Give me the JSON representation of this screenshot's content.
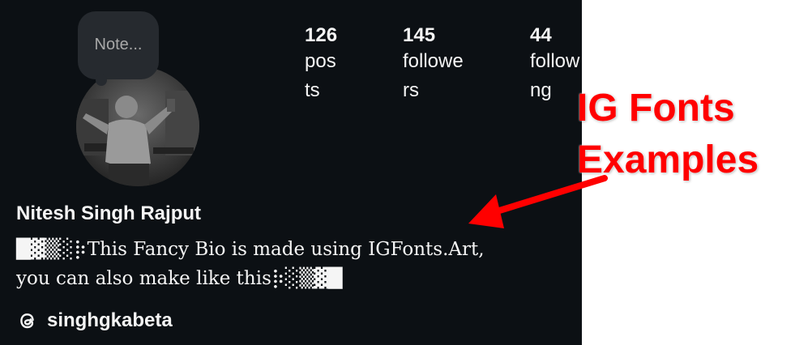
{
  "note": {
    "placeholder": "Note..."
  },
  "stats": [
    {
      "count": "126",
      "label_lines": [
        "pos",
        "ts"
      ]
    },
    {
      "count": "145",
      "label_lines": [
        "followe",
        "rs"
      ]
    },
    {
      "count": "44",
      "label_lines": [
        "follow",
        "ng"
      ]
    }
  ],
  "profile": {
    "full_name": "Nitesh Singh Rajput",
    "bio": "█▓▒░⡷This Fancy Bio is made using IGFonts.Art,\nyou can also make like this⡷░▒▓█",
    "threads_handle": "singhgkabeta"
  },
  "annotation": {
    "line1": "IG Fonts",
    "line2": "Examples",
    "color": "#ff0000"
  },
  "icons": {
    "threads": "threads-icon"
  },
  "colors": {
    "panel_bg": "#0c1014",
    "note_bg": "#262a2f",
    "text": "#f5f5f5"
  }
}
